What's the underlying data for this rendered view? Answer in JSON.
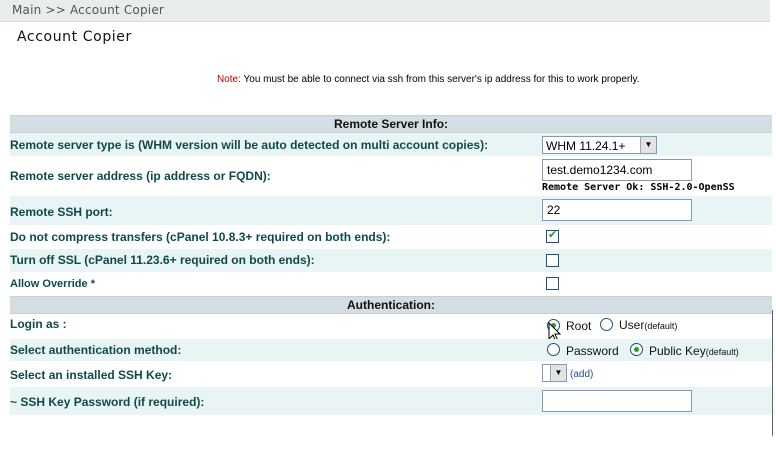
{
  "breadcrumb": "Main >> Account Copier",
  "page_title": "Account Copier",
  "note": {
    "label": "Note:",
    "text": " You must be able to connect via ssh from this server's ip address for this to work properly."
  },
  "sections": {
    "remote": "Remote Server Info:",
    "auth": "Authentication:"
  },
  "fields": {
    "server_type": {
      "label": "Remote server type is (WHM version will be auto detected on multi account copies):",
      "value": "WHM 11.24.1+"
    },
    "server_address": {
      "label": "Remote server address (ip address or FQDN):",
      "value": "test.demo1234.com",
      "status": "Remote Server Ok: SSH-2.0-OpenSS"
    },
    "ssh_port": {
      "label": "Remote SSH port:",
      "value": "22"
    },
    "no_compress": {
      "label": "Do not compress transfers (cPanel 10.8.3+ required on both ends):",
      "checked": true
    },
    "ssl_off": {
      "label": "Turn off SSL (cPanel 11.23.6+ required on both ends):",
      "checked": false
    },
    "allow_override": {
      "label": "Allow Override *",
      "checked": false
    },
    "login_as": {
      "label": "Login as :",
      "options": {
        "root": "Root",
        "user": "User",
        "user_note": "(default)"
      },
      "selected": "root"
    },
    "auth_method": {
      "label": "Select authentication method:",
      "options": {
        "password": "Password",
        "pubkey": "Public Key",
        "pubkey_note": "(default)"
      },
      "selected": "pubkey"
    },
    "ssh_key": {
      "label": "Select an installed SSH Key:",
      "value": "",
      "add_link": "(add)"
    },
    "key_password": {
      "label": "~ SSH Key Password (if required):",
      "value": ""
    }
  },
  "colors": {
    "label": "#0f4a4a",
    "section_bg": "#d3dde2",
    "alt_row": "#e9f4f4",
    "note_label": "#c00000",
    "check": "#21a121"
  },
  "icons": {
    "select_arrow": "chevron-down-icon",
    "checkmark": "check-icon",
    "cursor": "mouse-pointer-icon"
  }
}
